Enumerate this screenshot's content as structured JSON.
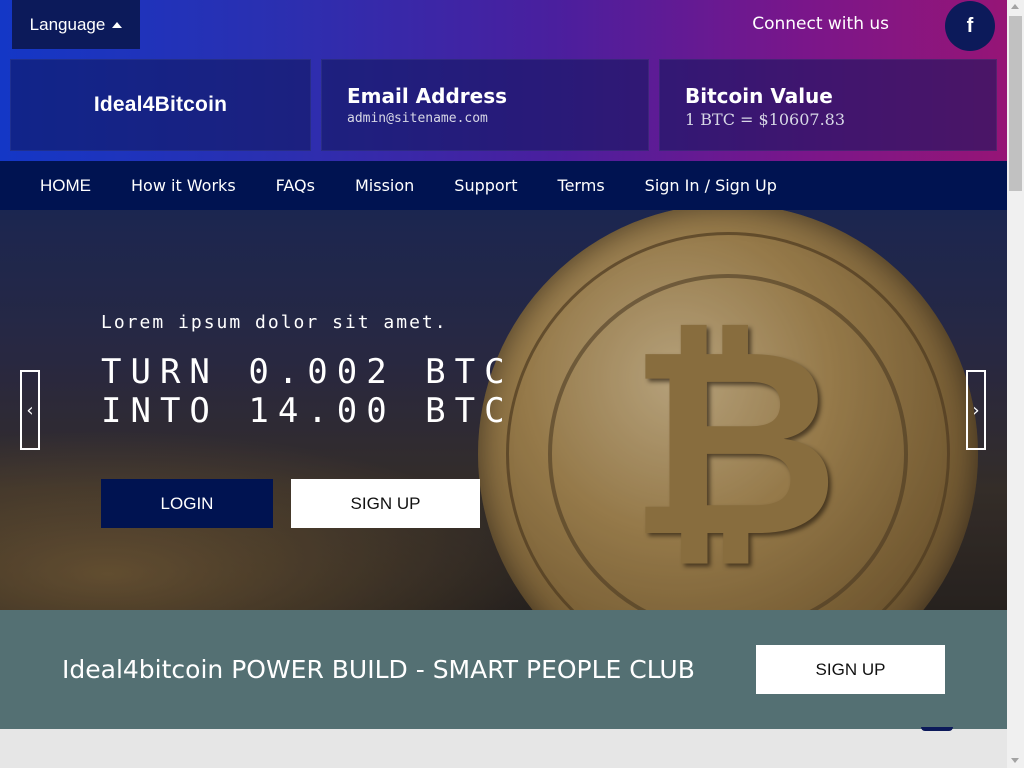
{
  "header": {
    "language_label": "Language",
    "connect_label": "Connect with us",
    "facebook_glyph": "f"
  },
  "info": {
    "logo_text": "Ideal4Bitcoin",
    "email_title": "Email Address",
    "email_value": "admin@sitename.com",
    "btc_title": "Bitcoin Value",
    "btc_value": "1 BTC = $10607.83"
  },
  "nav": {
    "items": [
      "HOME",
      "How it Works",
      "FAQs",
      "Mission",
      "Support",
      "Terms",
      "Sign In / Sign Up"
    ]
  },
  "hero": {
    "kicker": "Lorem ipsum dolor sit amet.",
    "title_line1": "TURN 0.002 BTC",
    "title_line2": "INTO 14.00 BTC",
    "login_label": "LOGIN",
    "signup_label": "SIGN UP",
    "prev_glyph": "‹",
    "next_glyph": "›",
    "coin_glyph": "₿"
  },
  "cta": {
    "text": "Ideal4bitcoin POWER BUILD - SMART PEOPLE CLUB",
    "button_label": "SIGN UP"
  },
  "colors": {
    "navy": "#001351",
    "cta_bg": "#547073",
    "gradient_start": "#1437c6",
    "gradient_end": "#961576"
  }
}
